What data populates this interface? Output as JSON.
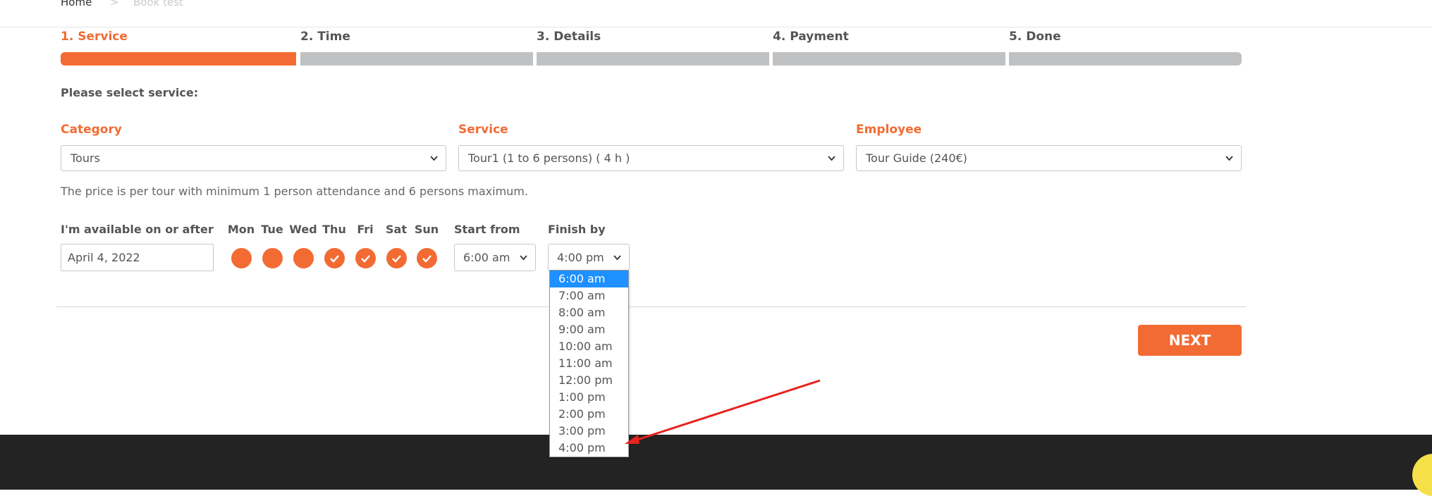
{
  "breadcrumb": {
    "home": "Home",
    "separator": ">",
    "current": "Book test"
  },
  "steps": [
    {
      "label": "1. Service",
      "active": true
    },
    {
      "label": "2. Time",
      "active": false
    },
    {
      "label": "3. Details",
      "active": false
    },
    {
      "label": "4. Payment",
      "active": false
    },
    {
      "label": "5. Done",
      "active": false
    }
  ],
  "section_title": "Please select service:",
  "category": {
    "label": "Category",
    "value": "Tours"
  },
  "service": {
    "label": "Service",
    "value": "Tour1 (1 to 6 persons) ( 4 h )"
  },
  "employee": {
    "label": "Employee",
    "value": "Tour Guide (240€)"
  },
  "note": "The price is per tour with minimum 1 person attendance and 6 persons maximum.",
  "availability": {
    "label": "I'm available on or after",
    "date": "April 4, 2022",
    "days": [
      {
        "label": "Mon",
        "checked": false
      },
      {
        "label": "Tue",
        "checked": false
      },
      {
        "label": "Wed",
        "checked": false
      },
      {
        "label": "Thu",
        "checked": true
      },
      {
        "label": "Fri",
        "checked": true
      },
      {
        "label": "Sat",
        "checked": true
      },
      {
        "label": "Sun",
        "checked": true
      }
    ],
    "start_label": "Start from",
    "start_value": "6:00 am",
    "finish_label": "Finish by",
    "finish_value": "4:00 pm",
    "finish_options": [
      "6:00 am",
      "7:00 am",
      "8:00 am",
      "9:00 am",
      "10:00 am",
      "11:00 am",
      "12:00 pm",
      "1:00 pm",
      "2:00 pm",
      "3:00 pm",
      "4:00 pm"
    ],
    "highlighted_option": "6:00 am"
  },
  "next_label": "NEXT",
  "colors": {
    "accent": "#f26b33",
    "bar_inactive": "#bfc1c3",
    "footer": "#232323",
    "highlight": "#1e90ff",
    "arrow": "#e8231f"
  },
  "icons": {
    "check": "check-icon",
    "chevron": "chevron-down-icon"
  }
}
